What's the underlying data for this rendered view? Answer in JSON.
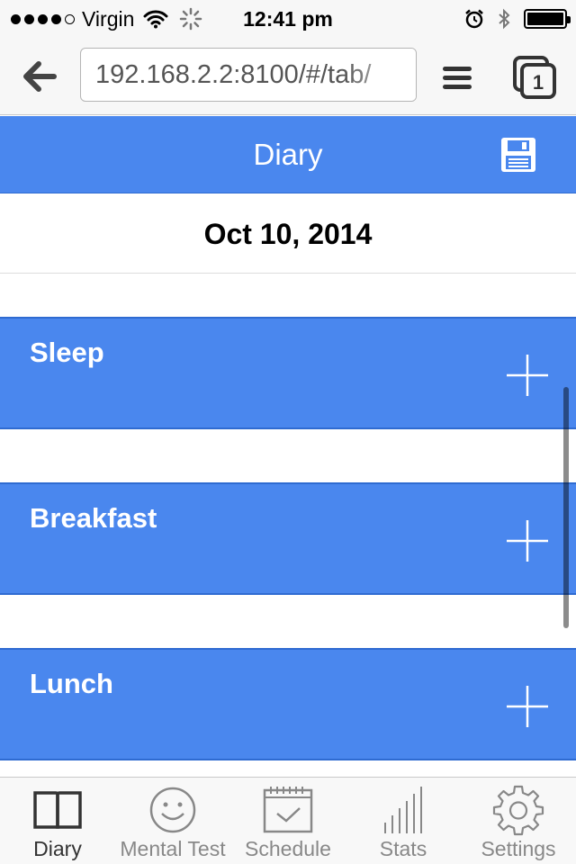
{
  "status_bar": {
    "carrier": "Virgin",
    "time": "12:41 pm"
  },
  "browser": {
    "url": "192.168.2.2:8100/#/tab/",
    "tab_count": "1"
  },
  "header": {
    "title": "Diary"
  },
  "date": "Oct 10, 2014",
  "meals": [
    {
      "title": "Sleep"
    },
    {
      "title": "Breakfast"
    },
    {
      "title": "Lunch"
    }
  ],
  "tabs": [
    {
      "label": "Diary",
      "icon": "book-icon",
      "active": true
    },
    {
      "label": "Mental Test",
      "icon": "smiley-icon",
      "active": false
    },
    {
      "label": "Schedule",
      "icon": "calendar-check-icon",
      "active": false
    },
    {
      "label": "Stats",
      "icon": "signal-bars-icon",
      "active": false
    },
    {
      "label": "Settings",
      "icon": "gear-icon",
      "active": false
    }
  ],
  "colors": {
    "accent": "#4a87ee",
    "accent_border": "#2f6bd1"
  }
}
